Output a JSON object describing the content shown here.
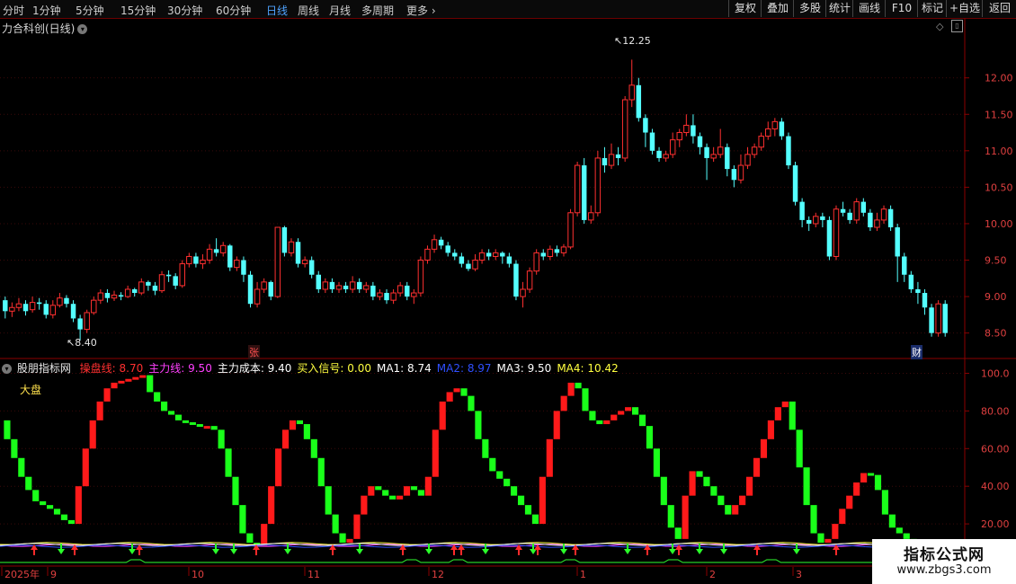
{
  "toolbar": {
    "periods": [
      "分时",
      "1分钟",
      "5分钟",
      "15分钟",
      "30分钟",
      "60分钟",
      "日线",
      "周线",
      "月线",
      "多周期",
      "更多"
    ],
    "active_period": "日线",
    "more_icon": "chevron-right-icon",
    "right_buttons": [
      "复权",
      "叠加",
      "多股",
      "统计",
      "画线",
      "F10",
      "标记",
      "+自选",
      "返回"
    ]
  },
  "stock": {
    "title": "力合科创(日线)",
    "high_label": "12.25",
    "low_label": "8.40",
    "marker_zhang": "张",
    "marker_cai": "财",
    "price_ticks": [
      "12.00",
      "11.50",
      "11.00",
      "10.50",
      "10.00",
      "9.50",
      "9.00",
      "8.50"
    ]
  },
  "indicator": {
    "name": "股朋指标网",
    "items": [
      {
        "label": "操盘线:",
        "value": "8.70",
        "color": "#ff3030"
      },
      {
        "label": "主力线:",
        "value": "9.50",
        "color": "#ff40ff"
      },
      {
        "label": "主力成本:",
        "value": "9.40",
        "color": "#ffffff"
      },
      {
        "label": "买入信号:",
        "value": "0.00",
        "color": "#ffff40"
      },
      {
        "label": "MA1:",
        "value": "8.74",
        "color": "#ffffff"
      },
      {
        "label": "MA2:",
        "value": "8.97",
        "color": "#3050ff"
      },
      {
        "label": "MA3:",
        "value": "9.50",
        "color": "#ffffff"
      },
      {
        "label": "MA4:",
        "value": "10.42",
        "color": "#ffff40"
      }
    ],
    "market_label": "大盘",
    "ticks": [
      "100.0",
      "80.00",
      "60.00",
      "40.00",
      "20.00"
    ]
  },
  "time_axis": {
    "labels": [
      "2025年",
      "9",
      "10",
      "11",
      "12",
      "1",
      "2",
      "3"
    ]
  },
  "watermark": {
    "line1": "指标公式网",
    "line2": "www.zbgs3.com"
  },
  "colors": {
    "up": "#ff3030",
    "down": "#54ffff",
    "osc_up": "#ff1a1a",
    "osc_down": "#1aff1a",
    "axis": "#8b0000"
  },
  "chart_data": {
    "type": "candlestick",
    "price_ylim": [
      8.2,
      12.6
    ],
    "candles": [
      [
        8.95,
        8.8,
        9.0,
        8.7
      ],
      [
        8.8,
        8.85,
        8.92,
        8.72
      ],
      [
        8.85,
        8.9,
        8.98,
        8.8
      ],
      [
        8.9,
        8.8,
        8.95,
        8.74
      ],
      [
        8.82,
        8.92,
        9.0,
        8.78
      ],
      [
        8.92,
        8.9,
        8.98,
        8.82
      ],
      [
        8.9,
        8.75,
        8.95,
        8.7
      ],
      [
        8.75,
        8.88,
        8.95,
        8.7
      ],
      [
        8.88,
        8.98,
        9.05,
        8.85
      ],
      [
        8.98,
        8.9,
        9.02,
        8.85
      ],
      [
        8.9,
        8.7,
        8.95,
        8.65
      ],
      [
        8.7,
        8.55,
        8.75,
        8.4
      ],
      [
        8.55,
        8.78,
        8.82,
        8.5
      ],
      [
        8.78,
        8.95,
        9.0,
        8.75
      ],
      [
        8.95,
        9.05,
        9.1,
        8.9
      ],
      [
        9.05,
        8.98,
        9.1,
        8.92
      ],
      [
        8.98,
        9.02,
        9.08,
        8.94
      ],
      [
        9.02,
        9.0,
        9.06,
        8.95
      ],
      [
        9.0,
        9.1,
        9.15,
        8.98
      ],
      [
        9.1,
        9.05,
        9.12,
        9.0
      ],
      [
        9.05,
        9.2,
        9.25,
        9.02
      ],
      [
        9.2,
        9.15,
        9.22,
        9.08
      ],
      [
        9.15,
        9.08,
        9.2,
        9.02
      ],
      [
        9.08,
        9.3,
        9.35,
        9.05
      ],
      [
        9.3,
        9.28,
        9.36,
        9.2
      ],
      [
        9.28,
        9.15,
        9.32,
        9.1
      ],
      [
        9.15,
        9.45,
        9.5,
        9.12
      ],
      [
        9.45,
        9.55,
        9.6,
        9.4
      ],
      [
        9.55,
        9.45,
        9.6,
        9.4
      ],
      [
        9.45,
        9.5,
        9.58,
        9.38
      ],
      [
        9.5,
        9.65,
        9.72,
        9.45
      ],
      [
        9.65,
        9.6,
        9.8,
        9.55
      ],
      [
        9.6,
        9.7,
        9.75,
        9.55
      ],
      [
        9.7,
        9.4,
        9.72,
        9.35
      ],
      [
        9.4,
        9.5,
        9.55,
        9.35
      ],
      [
        9.5,
        9.3,
        9.55,
        9.2
      ],
      [
        9.3,
        8.9,
        9.35,
        8.85
      ],
      [
        8.9,
        9.1,
        9.2,
        8.85
      ],
      [
        9.1,
        9.2,
        9.25,
        9.05
      ],
      [
        9.2,
        9.0,
        9.22,
        8.95
      ],
      [
        9.0,
        9.95,
        9.95,
        8.98
      ],
      [
        9.95,
        9.6,
        9.97,
        9.55
      ],
      [
        9.6,
        9.75,
        9.8,
        9.55
      ],
      [
        9.75,
        9.45,
        9.8,
        9.4
      ],
      [
        9.45,
        9.5,
        9.55,
        9.4
      ],
      [
        9.5,
        9.3,
        9.55,
        9.25
      ],
      [
        9.3,
        9.1,
        9.35,
        9.05
      ],
      [
        9.1,
        9.2,
        9.25,
        9.05
      ],
      [
        9.2,
        9.1,
        9.25,
        9.05
      ],
      [
        9.1,
        9.15,
        9.2,
        9.05
      ],
      [
        9.15,
        9.1,
        9.2,
        9.05
      ],
      [
        9.1,
        9.2,
        9.28,
        9.05
      ],
      [
        9.2,
        9.1,
        9.25,
        9.05
      ],
      [
        9.1,
        9.15,
        9.2,
        9.05
      ],
      [
        9.15,
        9.0,
        9.2,
        8.95
      ],
      [
        9.0,
        9.05,
        9.1,
        8.95
      ],
      [
        9.05,
        8.95,
        9.1,
        8.9
      ],
      [
        8.95,
        9.05,
        9.1,
        8.9
      ],
      [
        9.05,
        9.15,
        9.2,
        9.0
      ],
      [
        9.15,
        9.0,
        9.2,
        8.95
      ],
      [
        9.0,
        9.05,
        9.1,
        8.9
      ],
      [
        9.05,
        9.5,
        9.55,
        9.0
      ],
      [
        9.5,
        9.65,
        9.7,
        9.45
      ],
      [
        9.65,
        9.78,
        9.85,
        9.6
      ],
      [
        9.78,
        9.7,
        9.82,
        9.65
      ],
      [
        9.7,
        9.6,
        9.75,
        9.55
      ],
      [
        9.6,
        9.55,
        9.65,
        9.5
      ],
      [
        9.55,
        9.45,
        9.6,
        9.4
      ],
      [
        9.45,
        9.38,
        9.5,
        9.35
      ],
      [
        9.38,
        9.5,
        9.58,
        9.35
      ],
      [
        9.5,
        9.6,
        9.65,
        9.45
      ],
      [
        9.6,
        9.55,
        9.65,
        9.5
      ],
      [
        9.55,
        9.6,
        9.65,
        9.5
      ],
      [
        9.6,
        9.55,
        9.62,
        9.45
      ],
      [
        9.55,
        9.45,
        9.6,
        9.4
      ],
      [
        9.45,
        9.0,
        9.5,
        8.95
      ],
      [
        9.0,
        9.1,
        9.2,
        8.85
      ],
      [
        9.1,
        9.35,
        9.4,
        9.05
      ],
      [
        9.35,
        9.6,
        9.65,
        9.3
      ],
      [
        9.6,
        9.55,
        9.65,
        9.5
      ],
      [
        9.55,
        9.65,
        9.7,
        9.5
      ],
      [
        9.65,
        9.6,
        9.7,
        9.55
      ],
      [
        9.6,
        9.68,
        9.72,
        9.55
      ],
      [
        9.68,
        10.15,
        10.2,
        9.65
      ],
      [
        10.15,
        10.8,
        10.85,
        10.1
      ],
      [
        10.8,
        10.05,
        10.9,
        10.0
      ],
      [
        10.05,
        10.15,
        10.25,
        10.0
      ],
      [
        10.15,
        10.9,
        11.0,
        10.1
      ],
      [
        10.9,
        10.8,
        11.05,
        10.7
      ],
      [
        10.8,
        10.95,
        11.1,
        10.75
      ],
      [
        10.95,
        10.9,
        11.05,
        10.8
      ],
      [
        10.9,
        11.7,
        11.75,
        10.85
      ],
      [
        11.7,
        11.9,
        12.25,
        11.6
      ],
      [
        11.9,
        11.45,
        12.0,
        11.4
      ],
      [
        11.45,
        11.25,
        11.5,
        11.05
      ],
      [
        11.25,
        11.0,
        11.3,
        10.95
      ],
      [
        11.0,
        10.9,
        11.05,
        10.85
      ],
      [
        10.9,
        10.95,
        11.0,
        10.85
      ],
      [
        10.95,
        11.15,
        11.25,
        10.9
      ],
      [
        11.15,
        11.25,
        11.3,
        11.05
      ],
      [
        11.25,
        11.35,
        11.5,
        11.2
      ],
      [
        11.35,
        11.2,
        11.5,
        11.1
      ],
      [
        11.2,
        11.05,
        11.25,
        10.95
      ],
      [
        11.05,
        10.9,
        11.1,
        10.6
      ],
      [
        10.9,
        10.95,
        11.05,
        10.85
      ],
      [
        10.95,
        11.05,
        11.3,
        10.9
      ],
      [
        11.05,
        10.75,
        11.1,
        10.65
      ],
      [
        10.75,
        10.6,
        10.8,
        10.5
      ],
      [
        10.6,
        10.8,
        10.95,
        10.55
      ],
      [
        10.8,
        10.95,
        11.05,
        10.75
      ],
      [
        10.95,
        11.05,
        11.1,
        10.9
      ],
      [
        11.05,
        11.2,
        11.25,
        11.0
      ],
      [
        11.2,
        11.3,
        11.4,
        11.15
      ],
      [
        11.3,
        11.4,
        11.45,
        11.2
      ],
      [
        11.4,
        11.2,
        11.45,
        11.15
      ],
      [
        11.2,
        10.8,
        11.25,
        10.75
      ],
      [
        10.8,
        10.3,
        10.85,
        10.25
      ],
      [
        10.3,
        10.05,
        10.35,
        9.95
      ],
      [
        10.05,
        10.0,
        10.1,
        9.9
      ],
      [
        10.0,
        10.1,
        10.15,
        9.95
      ],
      [
        10.1,
        10.05,
        10.15,
        9.95
      ],
      [
        10.05,
        9.55,
        10.1,
        9.5
      ],
      [
        9.55,
        10.2,
        10.25,
        9.5
      ],
      [
        10.2,
        10.15,
        10.3,
        10.1
      ],
      [
        10.15,
        10.05,
        10.2,
        10.0
      ],
      [
        10.05,
        10.3,
        10.35,
        10.0
      ],
      [
        10.3,
        10.15,
        10.35,
        10.1
      ],
      [
        10.15,
        9.95,
        10.2,
        9.9
      ],
      [
        9.95,
        10.05,
        10.15,
        9.9
      ],
      [
        10.05,
        10.2,
        10.25,
        10.0
      ],
      [
        10.2,
        9.95,
        10.25,
        9.9
      ],
      [
        9.95,
        9.55,
        10.0,
        9.2
      ],
      [
        9.55,
        9.3,
        9.6,
        9.2
      ],
      [
        9.3,
        9.1,
        9.35,
        9.05
      ],
      [
        9.1,
        9.05,
        9.2,
        8.9
      ],
      [
        9.05,
        8.85,
        9.1,
        8.75
      ],
      [
        8.85,
        8.5,
        8.9,
        8.45
      ],
      [
        8.5,
        8.9,
        8.95,
        8.45
      ],
      [
        8.9,
        8.5,
        8.95,
        8.45
      ]
    ],
    "oscillator": {
      "ylim": [
        0,
        105
      ],
      "values": [
        75,
        65,
        55,
        45,
        38,
        32,
        30,
        28,
        25,
        22,
        20,
        40,
        60,
        75,
        85,
        92,
        95,
        96,
        97,
        98,
        99,
        90,
        85,
        80,
        78,
        75,
        74,
        73,
        72,
        72,
        70,
        60,
        45,
        30,
        15,
        10,
        8,
        20,
        40,
        60,
        70,
        75,
        73,
        65,
        55,
        40,
        25,
        15,
        10,
        12,
        25,
        35,
        40,
        38,
        35,
        33,
        35,
        40,
        38,
        35,
        45,
        70,
        85,
        90,
        92,
        88,
        80,
        65,
        55,
        48,
        44,
        40,
        35,
        30,
        25,
        20,
        45,
        65,
        80,
        88,
        95,
        92,
        80,
        75,
        73,
        75,
        78,
        80,
        82,
        78,
        72,
        60,
        45,
        30,
        18,
        12,
        35,
        48,
        45,
        40,
        35,
        30,
        25,
        30,
        35,
        45,
        55,
        65,
        75,
        82,
        85,
        70,
        50,
        30,
        15,
        10,
        12,
        20,
        28,
        35,
        42,
        47,
        46,
        38,
        25,
        18,
        15,
        12,
        10,
        8,
        6
      ]
    }
  }
}
